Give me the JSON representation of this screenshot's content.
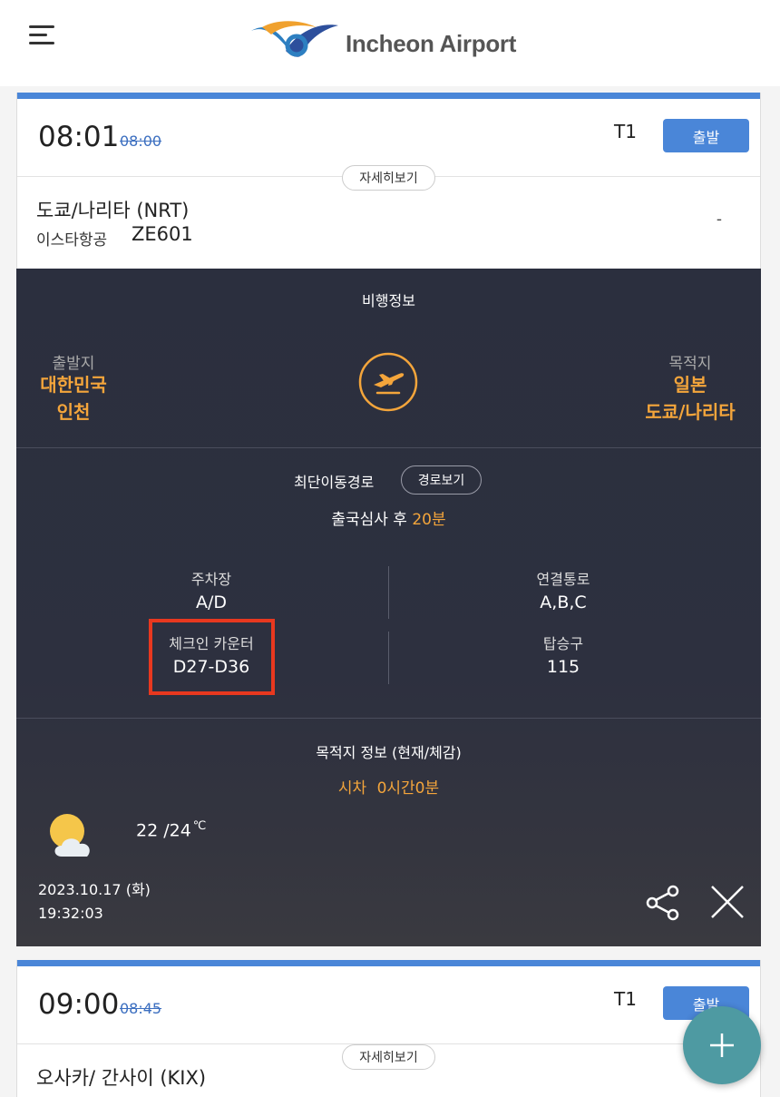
{
  "header": {
    "brand": "Incheon Airport",
    "menu_icon": "hamburger-menu-icon",
    "logo_icon": "incheon-airport-logo"
  },
  "flight1": {
    "time": "08:01",
    "scheduled_time": "08:00",
    "terminal": "T1",
    "status": "출발",
    "detail_button": "자세히보기",
    "destination": "도쿄/나리타 (NRT)",
    "airline": "이스타항공",
    "flight_no": "ZE601",
    "extra": "-"
  },
  "flight_info": {
    "title": "비행정보",
    "origin_label": "출발지",
    "origin_country": "대한민국",
    "origin_city": "인천",
    "dest_label": "목적지",
    "dest_country": "일본",
    "dest_city": "도쿄/나리타",
    "plane_icon": "departure-plane-icon"
  },
  "route": {
    "title": "최단이동경로",
    "button": "경로보기",
    "text_prefix": "출국심사 후",
    "minutes": "20분"
  },
  "facilities": {
    "parking_label": "주차장",
    "parking_value": "A/D",
    "connect_label": "연결통로",
    "connect_value": "A,B,C",
    "checkin_label": "체크인 카운터",
    "checkin_value": "D27-D36",
    "gate_label": "탑승구",
    "gate_value": "115",
    "highlight_color": "#e8381f"
  },
  "destination_info": {
    "title": "목적지 정보 (현재/체감)",
    "time_diff_label": "시차",
    "time_diff_value": "0시간0분",
    "weather_icon": "partly-cloudy-icon",
    "temp": "22 /24",
    "temp_unit": "℃",
    "date": "2023.10.17 (화)",
    "clock": "19:32:03",
    "share_icon": "share-icon",
    "close_icon": "close-icon"
  },
  "flight2": {
    "time": "09:00",
    "scheduled_time": "08:45",
    "terminal": "T1",
    "status": "출발",
    "detail_button": "자세히보기",
    "destination": "오사카/ 간사이 (KIX)"
  },
  "fab": {
    "icon": "plus-icon"
  },
  "colors": {
    "accent_blue": "#4a86d8",
    "orange": "#f4a53b",
    "dark_panel": "#2b2f3e",
    "fab": "#4e9aa2"
  }
}
